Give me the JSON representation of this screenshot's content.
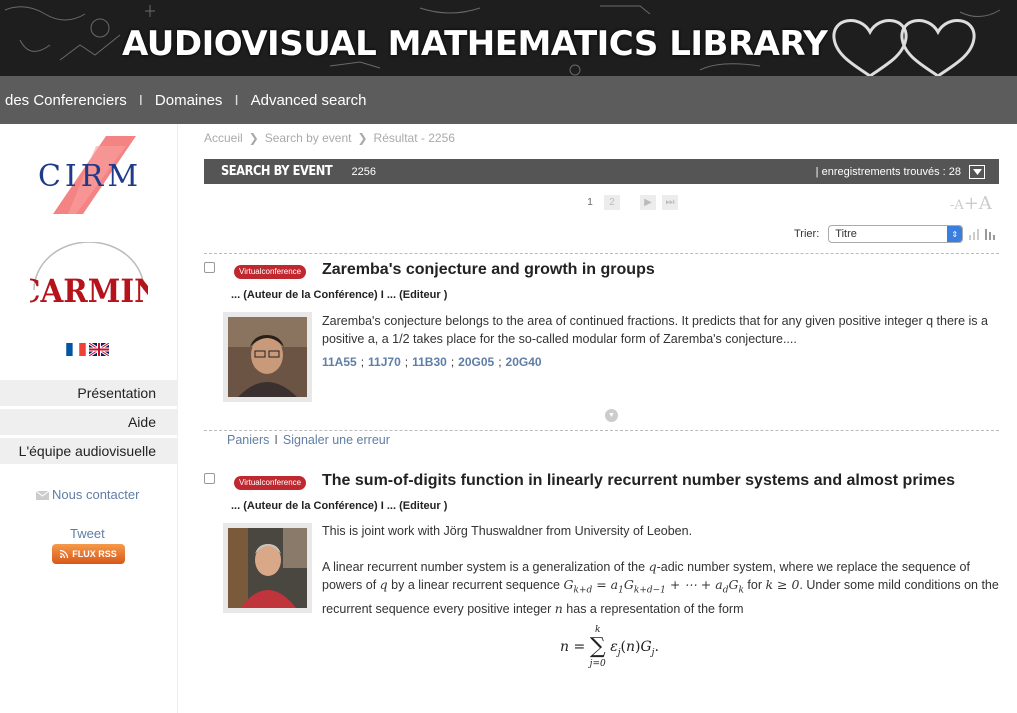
{
  "banner": {
    "title": "AUDIOVISUAL MATHEMATICS LIBRARY"
  },
  "nav": {
    "items": [
      "des Conferenciers",
      "Domaines",
      "Advanced search"
    ],
    "separator": "I"
  },
  "sidebar": {
    "cirm_logo": "CIRM",
    "carmin_logo": "CARMIN",
    "menu": [
      "Présentation",
      "Aide",
      "L'équipe audiovisuelle"
    ],
    "contact": "Nous contacter",
    "tweet": "Tweet",
    "rss": "FLUX RSS"
  },
  "breadcrumb": [
    "Accueil",
    "Search by event",
    "Résultat - 2256"
  ],
  "event_bar": {
    "title": "SEARCH BY EVENT",
    "number": "2256",
    "count_text": "| enregistrements trouvés : 28"
  },
  "pager": {
    "pages": [
      "1",
      "2"
    ]
  },
  "font_controls": {
    "decrease": "-A",
    "increase": "+A"
  },
  "sort": {
    "label": "Trier:",
    "selected": "Titre"
  },
  "records": [
    {
      "badge": "Virtualconference",
      "title": "Zaremba's conjecture and growth in groups",
      "authors": "... (Auteur de la Conférence) I ... (Editeur )",
      "abstract": "Zaremba's conjecture belongs to the area of continued fractions. It predicts that for any given positive integer q there is a positive a, a 1/2 takes place for the so-called modular form of Zaremba's conjecture....",
      "codes": [
        "11A55",
        "11J70",
        "11B30",
        "20G05",
        "20G40"
      ],
      "links": [
        "Paniers",
        "Signaler une erreur"
      ]
    },
    {
      "badge": "Virtualconference",
      "title": "The sum-of-digits function in linearly recurrent number systems and almost primes",
      "authors": "... (Auteur de la Conférence) I ... (Editeur )",
      "abstract_p1": "This is joint work with Jörg Thuswaldner from University of Leoben.",
      "abstract_p2_a": "A linear recurrent number system is a generalization of the ",
      "abstract_p2_q": "q",
      "abstract_p2_b": "-adic number system, where we replace the sequence of powers of ",
      "abstract_p2_c": " by a linear recurrent sequence ",
      "abstract_p2_formula": "G",
      "abstract_p2_d": " for ",
      "abstract_p2_cond": "k ≥ 0",
      "abstract_p2_e": ". Under some mild conditions on the recurrent sequence every positive integer ",
      "abstract_p2_n": "n",
      "abstract_p2_f": " has a representation of the form"
    }
  ],
  "colors": {
    "banner_bg": "#1e1e1e",
    "nav_bg": "#5c5c5c",
    "event_bar_bg": "#555555",
    "badge": "#c0282f",
    "link": "#5f7ea5",
    "select_arrow": "#3a7fe0"
  }
}
